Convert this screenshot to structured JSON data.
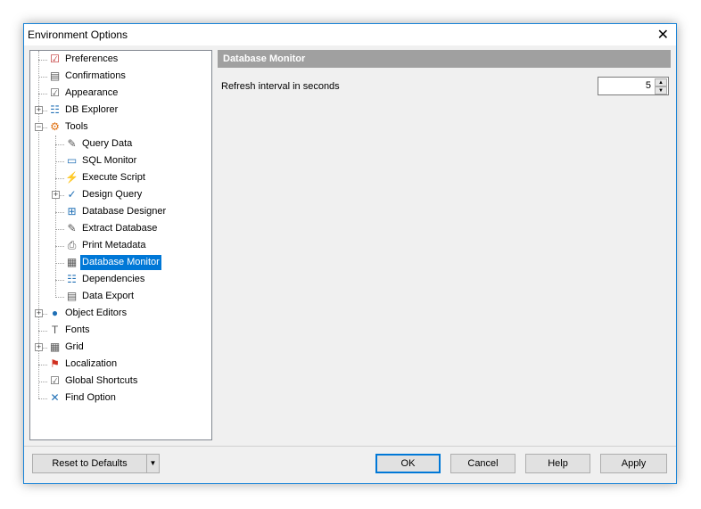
{
  "window": {
    "title": "Environment Options",
    "close_icon": "close-icon"
  },
  "tree": [
    {
      "label": "Preferences",
      "level": 0,
      "icon": "preferences-icon",
      "expander": null
    },
    {
      "label": "Confirmations",
      "level": 0,
      "icon": "confirmations-icon",
      "expander": null
    },
    {
      "label": "Appearance",
      "level": 0,
      "icon": "appearance-icon",
      "expander": null
    },
    {
      "label": "DB Explorer",
      "level": 0,
      "icon": "db-explorer-icon",
      "expander": "+"
    },
    {
      "label": "Tools",
      "level": 0,
      "icon": "tools-icon",
      "expander": "-"
    },
    {
      "label": "Query Data",
      "level": 1,
      "icon": "query-data-icon",
      "expander": null
    },
    {
      "label": "SQL Monitor",
      "level": 1,
      "icon": "sql-monitor-icon",
      "expander": null
    },
    {
      "label": "Execute Script",
      "level": 1,
      "icon": "execute-script-icon",
      "expander": null
    },
    {
      "label": "Design Query",
      "level": 1,
      "icon": "design-query-icon",
      "expander": "+"
    },
    {
      "label": "Database Designer",
      "level": 1,
      "icon": "database-designer-icon",
      "expander": null
    },
    {
      "label": "Extract Database",
      "level": 1,
      "icon": "extract-database-icon",
      "expander": null
    },
    {
      "label": "Print Metadata",
      "level": 1,
      "icon": "print-metadata-icon",
      "expander": null
    },
    {
      "label": "Database Monitor",
      "level": 1,
      "icon": "database-monitor-icon",
      "expander": null,
      "selected": true
    },
    {
      "label": "Dependencies",
      "level": 1,
      "icon": "dependencies-icon",
      "expander": null
    },
    {
      "label": "Data Export",
      "level": 1,
      "icon": "data-export-icon",
      "expander": null
    },
    {
      "label": "Object Editors",
      "level": 0,
      "icon": "object-editors-icon",
      "expander": "+"
    },
    {
      "label": "Fonts",
      "level": 0,
      "icon": "fonts-icon",
      "expander": null
    },
    {
      "label": "Grid",
      "level": 0,
      "icon": "grid-icon",
      "expander": "+"
    },
    {
      "label": "Localization",
      "level": 0,
      "icon": "localization-icon",
      "expander": null
    },
    {
      "label": "Global Shortcuts",
      "level": 0,
      "icon": "global-shortcuts-icon",
      "expander": null
    },
    {
      "label": "Find Option",
      "level": 0,
      "icon": "find-option-icon",
      "expander": null
    }
  ],
  "panel": {
    "header": "Database Monitor",
    "refresh_label": "Refresh interval in seconds",
    "refresh_value": "5"
  },
  "buttons": {
    "reset": "Reset to Defaults",
    "ok": "OK",
    "cancel": "Cancel",
    "help": "Help",
    "apply": "Apply"
  },
  "colors": {
    "accent": "#0078d7",
    "header_bg": "#a0a0a0"
  }
}
